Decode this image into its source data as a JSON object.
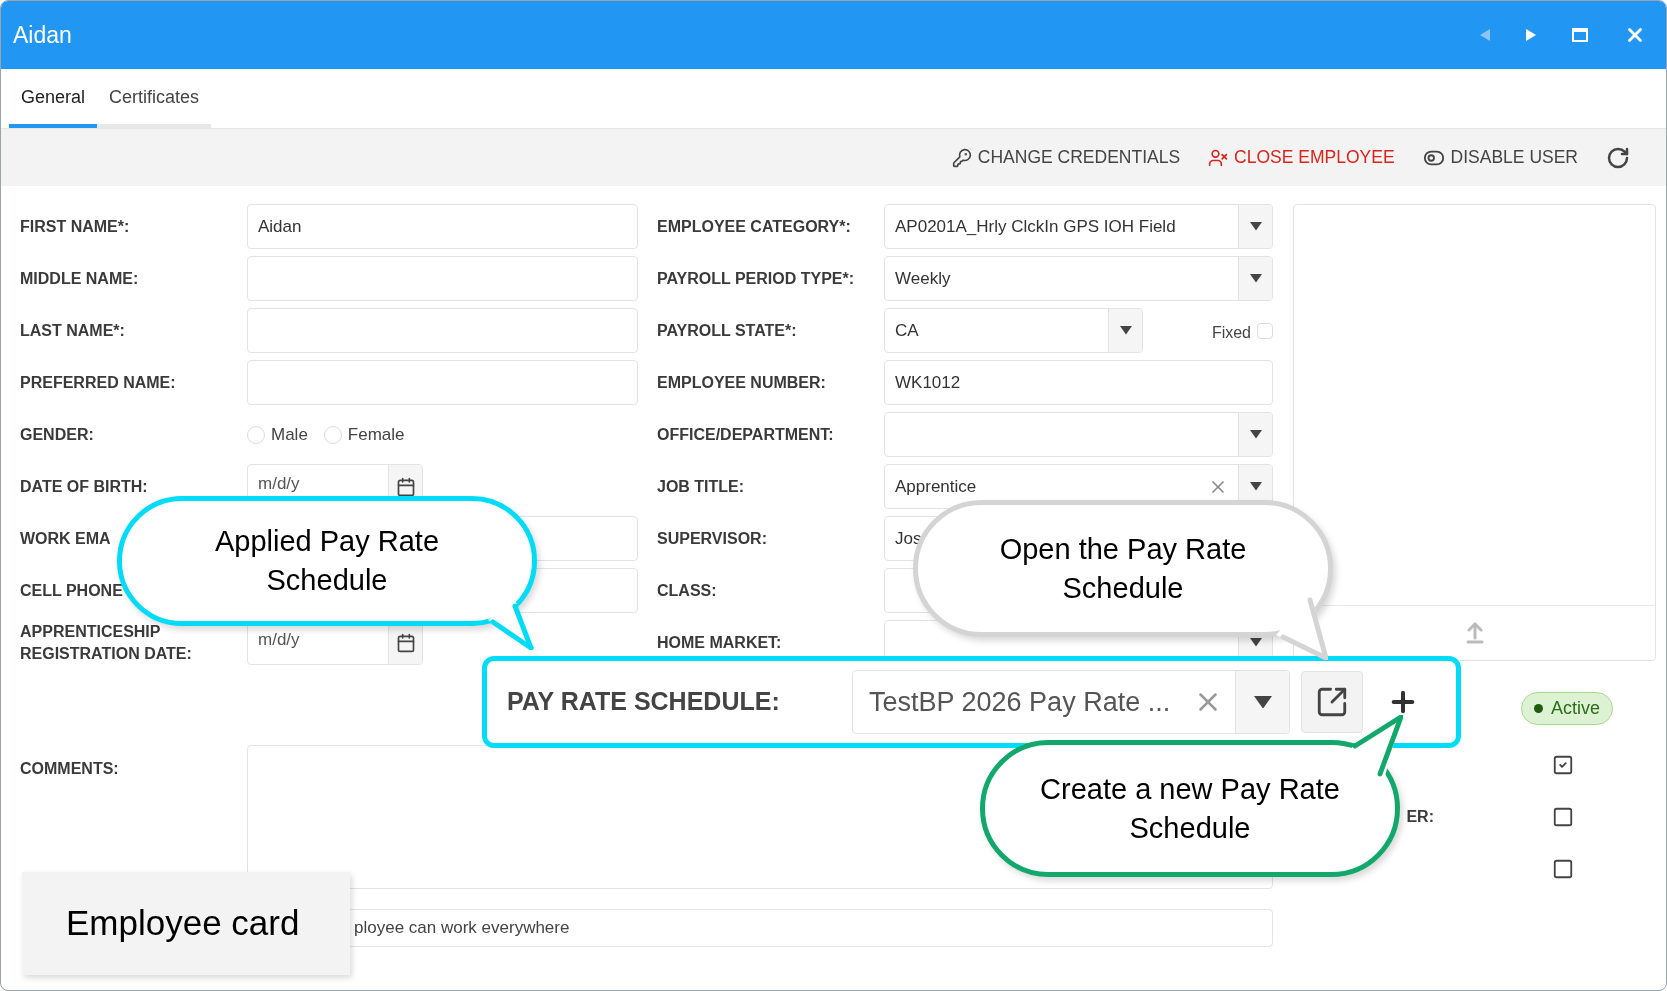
{
  "window": {
    "title": "Aidan"
  },
  "tabs": [
    {
      "label": "General",
      "selected": true
    },
    {
      "label": "Certificates",
      "selected": false
    }
  ],
  "toolbar": [
    {
      "kind": "credentials",
      "label": "CHANGE CREDENTIALS"
    },
    {
      "kind": "close",
      "label": "CLOSE EMPLOYEE"
    },
    {
      "kind": "disable",
      "label": "DISABLE USER"
    },
    {
      "kind": "refresh"
    }
  ],
  "left_fields": [
    {
      "label": "FIRST NAME*:",
      "kind": "text",
      "value": "Aidan"
    },
    {
      "label": "MIDDLE NAME:",
      "kind": "text"
    },
    {
      "label": "LAST NAME*:",
      "kind": "text"
    },
    {
      "label": "PREFERRED NAME:",
      "kind": "text"
    },
    {
      "label": "GENDER:",
      "kind": "radio",
      "options": [
        {
          "label": "Male",
          "selected": false
        },
        {
          "label": "Female",
          "selected": false
        }
      ]
    },
    {
      "label": "DATE OF BIRTH:",
      "kind": "date",
      "placeholder": "m/d/y"
    },
    {
      "label": "WORK EMA",
      "kind": "text"
    },
    {
      "label": "CELL PHONE",
      "kind": "text"
    },
    {
      "label": "APPRENTICESHIP REGISTRATION DATE:",
      "kind": "date",
      "placeholder": "m/d/y"
    }
  ],
  "middle_fields": [
    {
      "label": "EMPLOYEE CATEGORY*:",
      "kind": "select",
      "value": "AP0201A_Hrly ClckIn GPS IOH Field"
    },
    {
      "label": "PAYROLL PERIOD TYPE*:",
      "kind": "select",
      "value": "Weekly"
    },
    {
      "label": "PAYROLL STATE*:",
      "kind": "select_fixed",
      "value": "CA",
      "fixed_label": "Fixed",
      "fixed": false
    },
    {
      "label": "EMPLOYEE NUMBER:",
      "kind": "text",
      "value": "WK1012"
    },
    {
      "label": "OFFICE/DEPARTMENT:",
      "kind": "select"
    },
    {
      "label": "JOB TITLE:",
      "kind": "select",
      "value": "Apprentice",
      "clearable": true
    },
    {
      "label": "SUPERVISOR:",
      "kind": "text",
      "value": "Jos"
    },
    {
      "label": "CLASS:",
      "kind": "text"
    },
    {
      "label": "HOME MARKET:",
      "kind": "select"
    }
  ],
  "status": {
    "label": "Active"
  },
  "flags": [
    {
      "checked": true
    },
    {
      "label": "ER:",
      "checked": false
    },
    {
      "checked": false
    }
  ],
  "comments": {
    "label": "COMMENTS:"
  },
  "restrict": {
    "value": "ployee can work everywhere"
  },
  "pay_rate_highlight": {
    "label": "PAY RATE SCHEDULE:",
    "value": "TestBP 2026 Pay Rate ..."
  },
  "callouts": [
    {
      "text": "Applied Pay Rate Schedule",
      "color": "#00dcf8"
    },
    {
      "text": "Open the Pay Rate Schedule",
      "color": "#d4d4d4"
    },
    {
      "text": "Create a new Pay Rate Schedule",
      "color": "#12a86b"
    }
  ],
  "caption": {
    "text": "Employee card"
  }
}
